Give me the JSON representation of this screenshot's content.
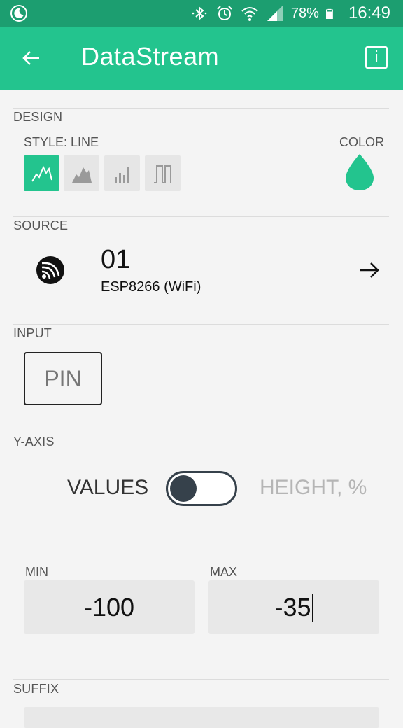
{
  "status_bar": {
    "battery": "78%",
    "time": "16:49",
    "icons": [
      "moon-icon",
      "bluetooth-icon",
      "alarm-icon",
      "wifi-icon",
      "signal-icon",
      "battery-icon"
    ]
  },
  "app_bar": {
    "title": "DataStream",
    "info_label": "i",
    "icons": [
      "back-arrow-icon",
      "info-icon"
    ]
  },
  "design": {
    "label": "DESIGN",
    "style_label": "STYLE: LINE",
    "color_label": "COLOR",
    "styles": [
      "line",
      "area",
      "bar",
      "binary"
    ],
    "selected_style": "line",
    "accent_color": "#23c48e"
  },
  "source": {
    "label": "SOURCE",
    "name": "01",
    "device": "ESP8266 (WiFi)"
  },
  "input": {
    "label": "INPUT",
    "pin_label": "PIN"
  },
  "y_axis": {
    "label": "Y-AXIS",
    "left_option": "VALUES",
    "right_option": "HEIGHT, %",
    "toggle_state": "VALUES"
  },
  "range": {
    "min_label": "MIN",
    "min_value": "-100",
    "max_label": "MAX",
    "max_value": "-35"
  },
  "suffix": {
    "label": "SUFFIX"
  }
}
